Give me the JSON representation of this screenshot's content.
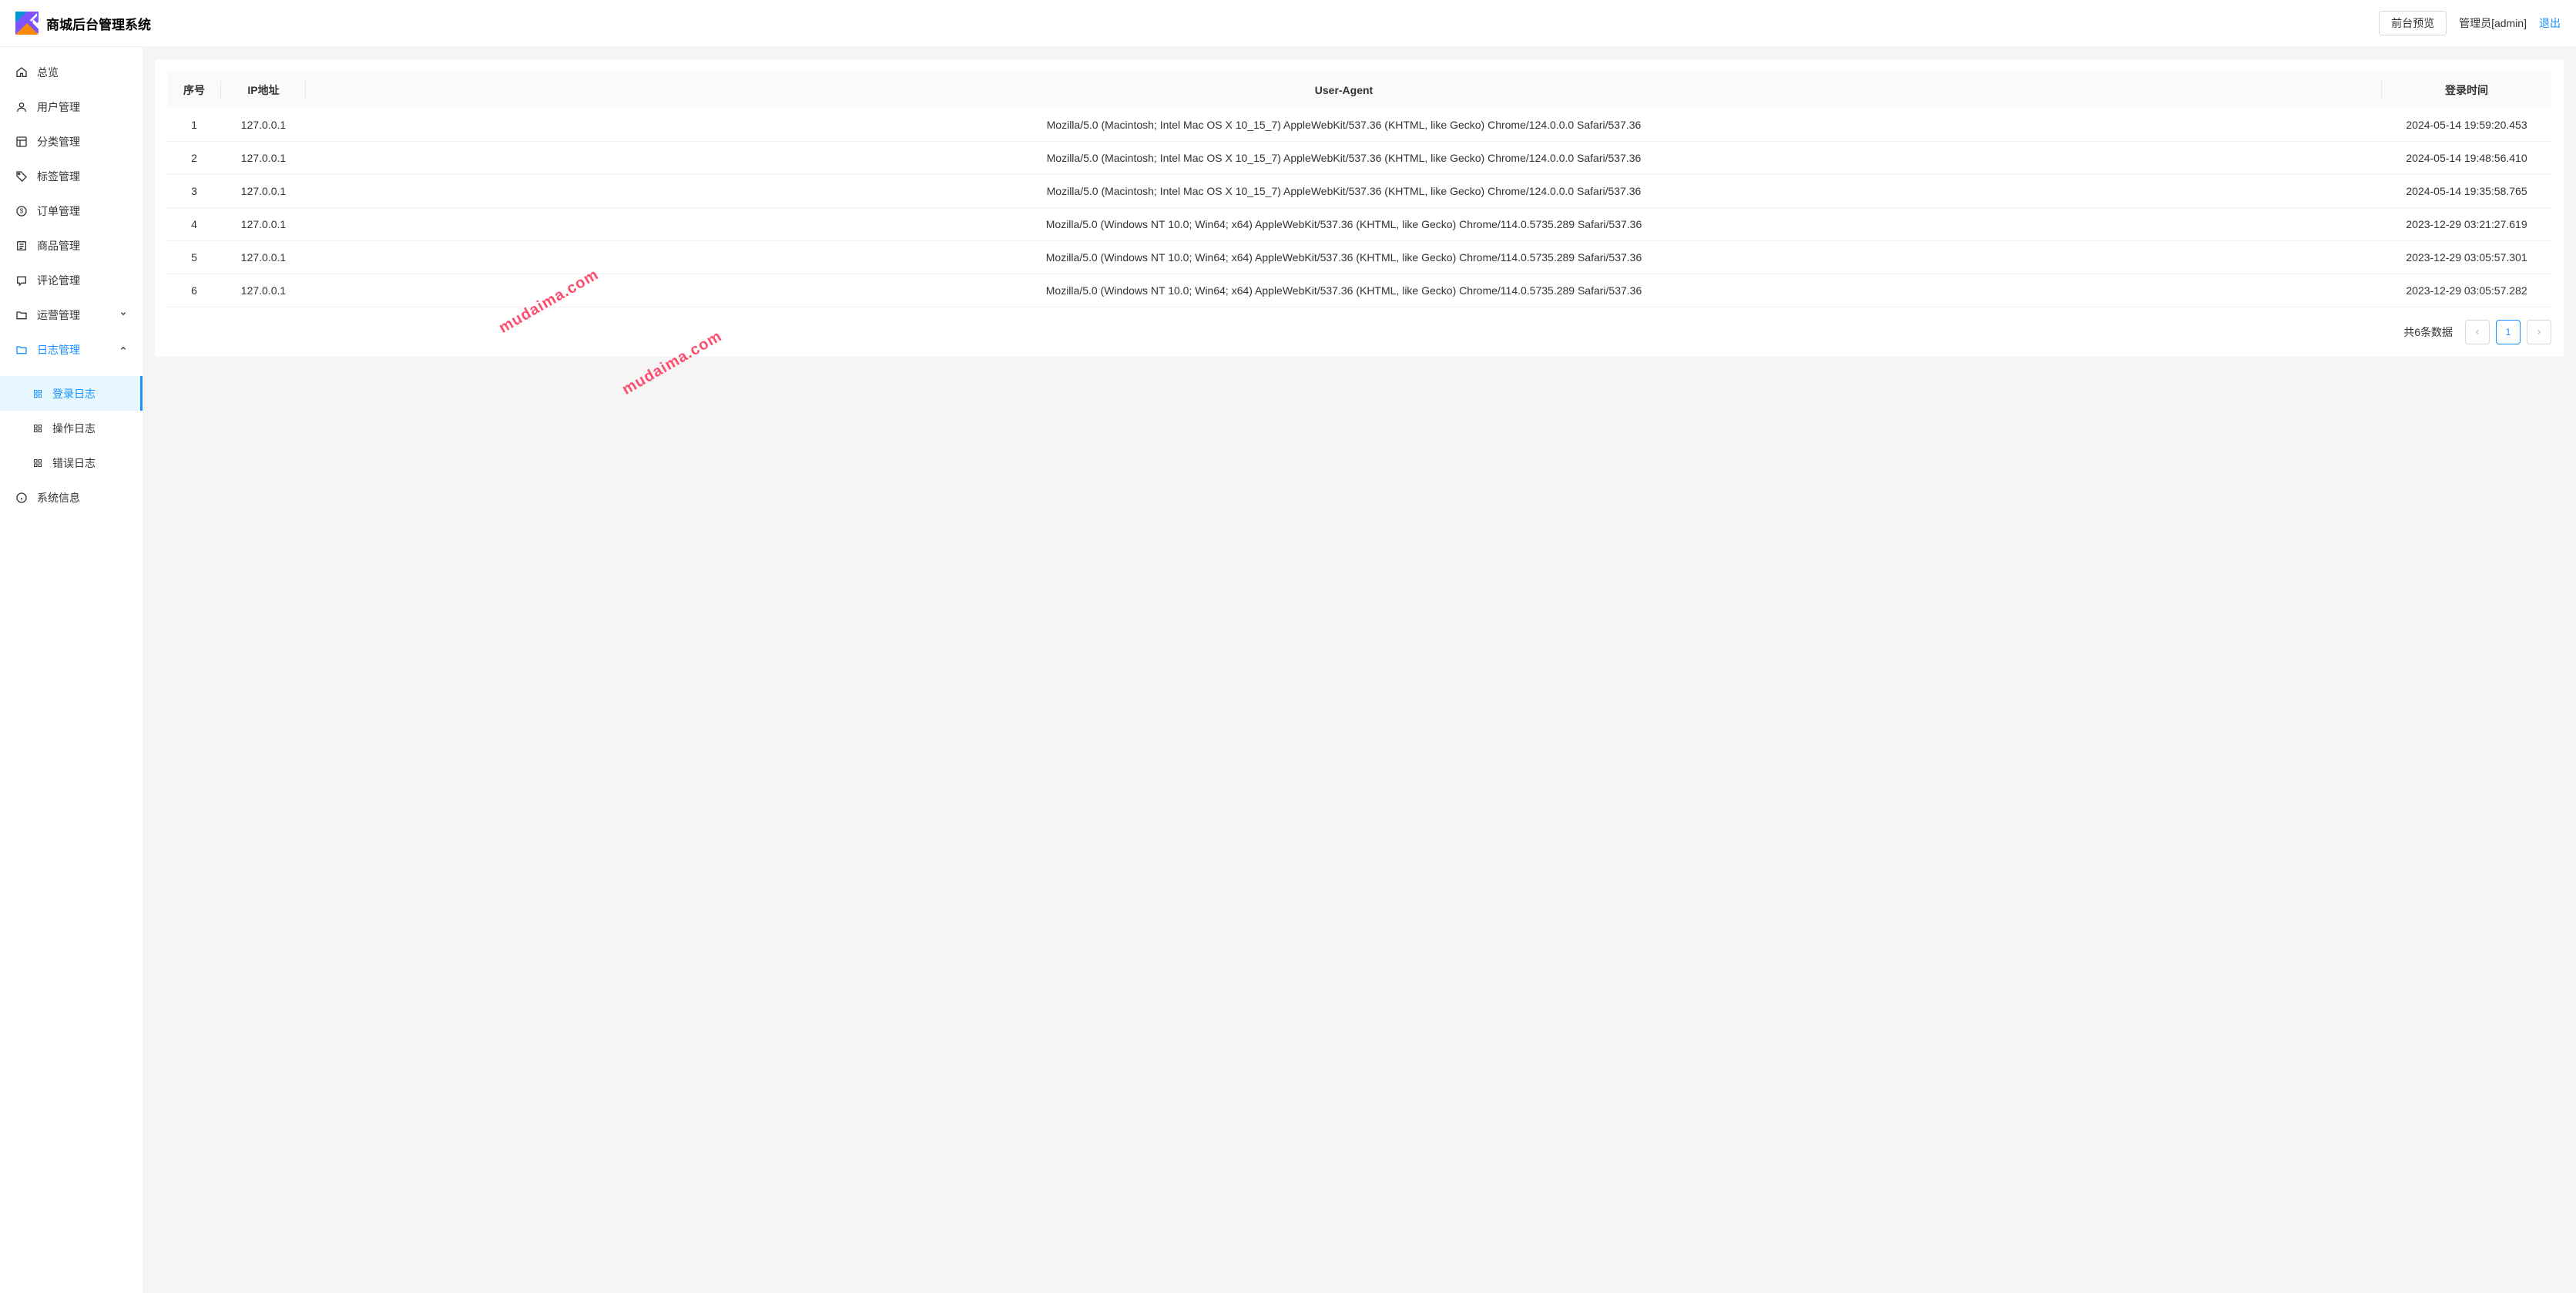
{
  "header": {
    "title": "商城后台管理系统",
    "preview_button": "前台预览",
    "user_label": "管理员[admin]",
    "logout": "退出"
  },
  "sidebar": {
    "items": [
      {
        "label": "总览",
        "icon": "home"
      },
      {
        "label": "用户管理",
        "icon": "user"
      },
      {
        "label": "分类管理",
        "icon": "category"
      },
      {
        "label": "标签管理",
        "icon": "tag"
      },
      {
        "label": "订单管理",
        "icon": "order"
      },
      {
        "label": "商品管理",
        "icon": "product"
      },
      {
        "label": "评论管理",
        "icon": "comment"
      },
      {
        "label": "运营管理",
        "icon": "folder",
        "expandable": true,
        "expanded": false
      },
      {
        "label": "日志管理",
        "icon": "folder",
        "expandable": true,
        "expanded": true,
        "active": true
      },
      {
        "label": "系统信息",
        "icon": "info"
      }
    ],
    "log_submenu": [
      {
        "label": "登录日志",
        "active": true
      },
      {
        "label": "操作日志"
      },
      {
        "label": "错误日志"
      }
    ]
  },
  "table": {
    "columns": {
      "seq": "序号",
      "ip": "IP地址",
      "ua": "User-Agent",
      "time": "登录时间"
    },
    "rows": [
      {
        "seq": "1",
        "ip": "127.0.0.1",
        "ua": "Mozilla/5.0 (Macintosh; Intel Mac OS X 10_15_7) AppleWebKit/537.36 (KHTML, like Gecko) Chrome/124.0.0.0 Safari/537.36",
        "time": "2024-05-14 19:59:20.453"
      },
      {
        "seq": "2",
        "ip": "127.0.0.1",
        "ua": "Mozilla/5.0 (Macintosh; Intel Mac OS X 10_15_7) AppleWebKit/537.36 (KHTML, like Gecko) Chrome/124.0.0.0 Safari/537.36",
        "time": "2024-05-14 19:48:56.410"
      },
      {
        "seq": "3",
        "ip": "127.0.0.1",
        "ua": "Mozilla/5.0 (Macintosh; Intel Mac OS X 10_15_7) AppleWebKit/537.36 (KHTML, like Gecko) Chrome/124.0.0.0 Safari/537.36",
        "time": "2024-05-14 19:35:58.765"
      },
      {
        "seq": "4",
        "ip": "127.0.0.1",
        "ua": "Mozilla/5.0 (Windows NT 10.0; Win64; x64) AppleWebKit/537.36 (KHTML, like Gecko) Chrome/114.0.5735.289 Safari/537.36",
        "time": "2023-12-29 03:21:27.619"
      },
      {
        "seq": "5",
        "ip": "127.0.0.1",
        "ua": "Mozilla/5.0 (Windows NT 10.0; Win64; x64) AppleWebKit/537.36 (KHTML, like Gecko) Chrome/114.0.5735.289 Safari/537.36",
        "time": "2023-12-29 03:05:57.301"
      },
      {
        "seq": "6",
        "ip": "127.0.0.1",
        "ua": "Mozilla/5.0 (Windows NT 10.0; Win64; x64) AppleWebKit/537.36 (KHTML, like Gecko) Chrome/114.0.5735.289 Safari/537.36",
        "time": "2023-12-29 03:05:57.282"
      }
    ]
  },
  "pagination": {
    "total_text": "共6条数据",
    "current": "1"
  },
  "watermark": "mudaima.com"
}
